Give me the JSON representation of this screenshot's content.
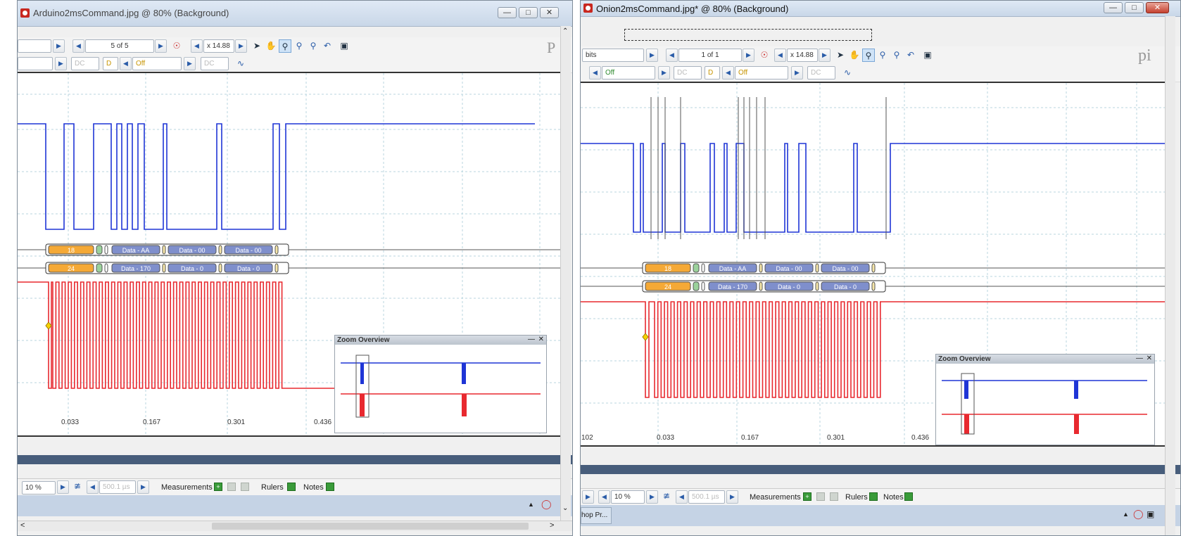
{
  "left_window": {
    "title": "Arduino2msCommand.jpg @  80% (Background)",
    "page_indicator": "5 of 5",
    "zoom_factor": "x 14.88",
    "channel_a_coupling": "DC",
    "channel_b_coupling": "DC",
    "trigger_mode": "Off",
    "d_label": "D",
    "logo_fragment": "P",
    "axis_ticks": [
      "0.033",
      "0.167",
      "0.301",
      "0.436"
    ],
    "decode_row_1": [
      "18",
      "Data - AA",
      "Data - 00",
      "Data - 00"
    ],
    "decode_row_2": [
      "24",
      "Data - 170",
      "Data - 0",
      "Data - 0"
    ],
    "zoom_overview_title": "Zoom Overview",
    "zoom_percent": "10 %",
    "time_readout": "500.1 µs",
    "measurements_label": "Measurements",
    "rulers_label": "Rulers",
    "notes_label": "Notes"
  },
  "right_window": {
    "title": "Onion2msCommand.jpg* @  80% (Background)",
    "left_dropdown": "bits",
    "page_indicator": "1 of 1",
    "zoom_factor": "x 14.88",
    "channel_a_coupling": "DC",
    "channel_b_coupling": "DC",
    "trigger_mode_a": "Off",
    "trigger_mode_b": "Off",
    "d_label": "D",
    "logo_fragment": "pi",
    "axis_ticks": [
      "102",
      "0.033",
      "0.167",
      "0.301",
      "0.436"
    ],
    "decode_row_1": [
      "18",
      "Data - AA",
      "Data - 00",
      "Data - 00"
    ],
    "decode_row_2": [
      "24",
      "Data - 170",
      "Data - 0",
      "Data - 0"
    ],
    "zoom_overview_title": "Zoom Overview",
    "zoom_percent": "10 %",
    "time_readout": "500.1 µs",
    "measurements_label": "Measurements",
    "rulers_label": "Rulers",
    "notes_label": "Notes",
    "taskbar_fragment": "hop Pr..."
  },
  "colors": {
    "channel_a": "#1f35d6",
    "channel_b": "#e8292f",
    "decode_byte": "#f5a936",
    "decode_data": "#7f8fcc"
  }
}
